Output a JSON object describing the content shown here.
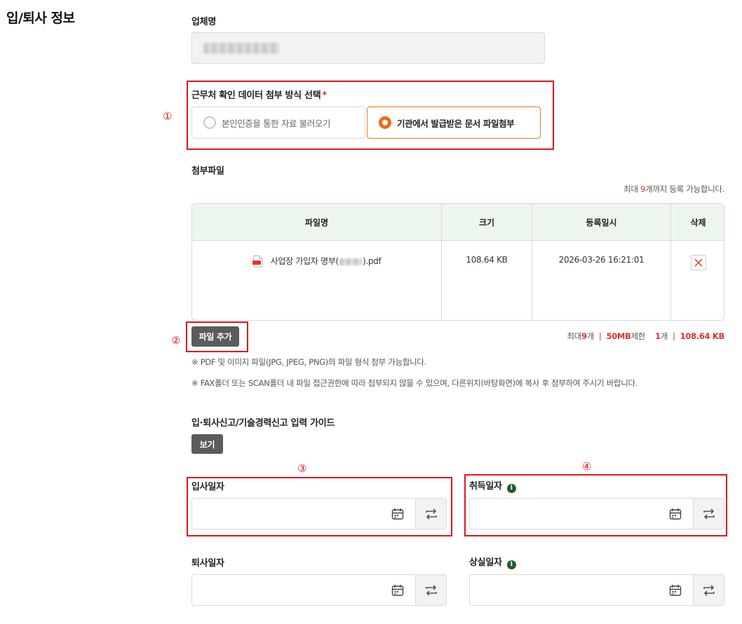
{
  "section": {
    "title": "입/퇴사 정보"
  },
  "company": {
    "label": "업체명"
  },
  "attach_method": {
    "label": "근무처 확인 데이터 첨부 방식 선택",
    "required_mark": "*",
    "options": [
      {
        "label": "본인인증을 통한 자료 불러오기",
        "selected": false
      },
      {
        "label": "기관에서 발급받은 문서 파일첨부",
        "selected": true
      }
    ]
  },
  "callouts": [
    "①",
    "②",
    "③",
    "④"
  ],
  "attachments": {
    "label": "첨부파일",
    "limit_note_pre": "최대 ",
    "limit_note_num": "9",
    "limit_note_post": "개까지 등록 가능합니다.",
    "columns": [
      "파일명",
      "크기",
      "등록일시",
      "삭제"
    ],
    "rows": [
      {
        "name_prefix": "사업장 가입자 명부(",
        "name_suffix": ").pdf",
        "size": "108.64 KB",
        "date": "2026-03-26 16:21:01"
      }
    ],
    "add_button": "파일 추가",
    "limit_summary": {
      "pre_max": "최대 ",
      "max_count": "9",
      "max_unit": "개",
      "size_limit": "50MB",
      "size_suffix": "제한",
      "current_count": "1",
      "current_unit": "개",
      "current_size": "108.64 KB"
    },
    "notes": [
      "※ PDF 및 이미지 파일(JPG, JPEG, PNG)의 파일 형식 첨부 가능합니다.",
      "※ FAX폴더 또는 SCAN폴더 내 파일 접근권한에 따라 첨부되지 않을 수 있으며, 다른위치(바탕화면)에 복사 후 첨부하여 주시기 바랍니다."
    ]
  },
  "guide": {
    "label": "입·퇴사신고/기술경력신고 입력 가이드",
    "button": "보기"
  },
  "dates": {
    "join": {
      "label": "입사일자"
    },
    "acquire": {
      "label": "취득일자",
      "info": "i"
    },
    "leave": {
      "label": "퇴사일자"
    },
    "loss": {
      "label": "상실일자",
      "info": "i"
    }
  },
  "colors": {
    "accent_orange": "#ec6d1f",
    "highlight_red": "#e0141b",
    "table_header_bg": "#edf5ef",
    "dark_button": "#5b5b5b",
    "info_green": "#1f5c2f"
  }
}
